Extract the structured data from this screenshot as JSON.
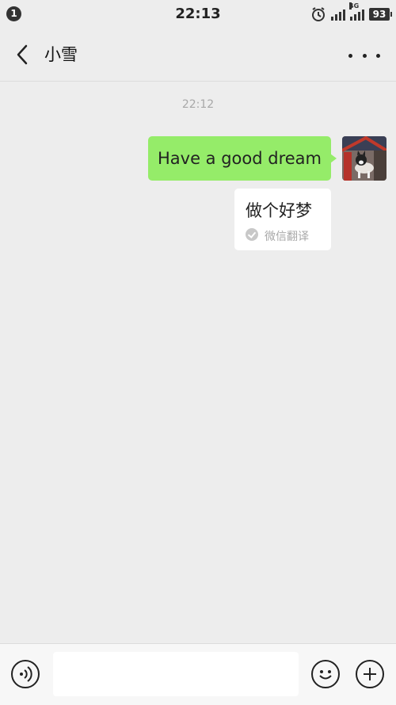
{
  "status_bar": {
    "notification_count": "1",
    "time": "22:13",
    "network_tag": "4G",
    "battery": "93",
    "icons": [
      "alarm-icon",
      "signal-icon",
      "signal-4g-icon",
      "battery-icon"
    ]
  },
  "header": {
    "title": "小雪",
    "back_icon": "back-arrow-icon",
    "more_icon": "more-icon"
  },
  "chat": {
    "timestamp": "22:12",
    "messages": [
      {
        "side": "right",
        "text": "Have a good dream",
        "bubble_color": "#95ec69",
        "translation": {
          "text": "做个好梦",
          "label": "微信翻译"
        }
      }
    ]
  },
  "input_bar": {
    "placeholder": "",
    "value": "",
    "icons": [
      "voice-icon",
      "emoji-icon",
      "plus-icon"
    ]
  },
  "colors": {
    "background": "#ededed",
    "bubble_sent": "#95ec69",
    "timestamp_text": "#a8a8a8"
  }
}
